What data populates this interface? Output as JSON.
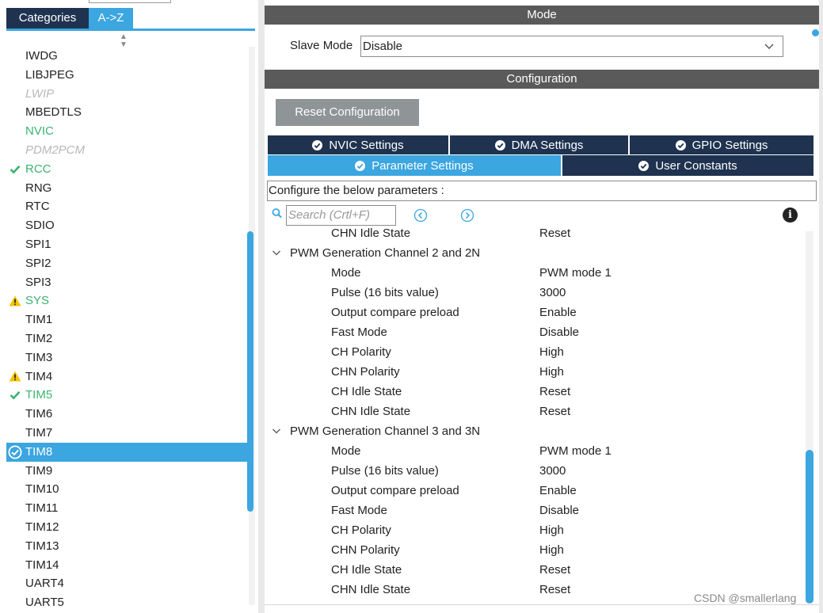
{
  "left_panel": {
    "tabs": [
      {
        "label": "Categories",
        "active": false
      },
      {
        "label": "A->Z",
        "active": true
      }
    ],
    "items": [
      {
        "label": "IWDG",
        "status": "normal",
        "icon": ""
      },
      {
        "label": "LIBJPEG",
        "status": "normal",
        "icon": ""
      },
      {
        "label": "LWIP",
        "status": "disabled",
        "icon": ""
      },
      {
        "label": "MBEDTLS",
        "status": "normal",
        "icon": ""
      },
      {
        "label": "NVIC",
        "status": "green",
        "icon": ""
      },
      {
        "label": "PDM2PCM",
        "status": "disabled",
        "icon": ""
      },
      {
        "label": "RCC",
        "status": "green",
        "icon": "check-icon"
      },
      {
        "label": "RNG",
        "status": "normal",
        "icon": ""
      },
      {
        "label": "RTC",
        "status": "normal",
        "icon": ""
      },
      {
        "label": "SDIO",
        "status": "normal",
        "icon": ""
      },
      {
        "label": "SPI1",
        "status": "normal",
        "icon": ""
      },
      {
        "label": "SPI2",
        "status": "normal",
        "icon": ""
      },
      {
        "label": "SPI3",
        "status": "normal",
        "icon": ""
      },
      {
        "label": "SYS",
        "status": "green",
        "icon": "warning-icon"
      },
      {
        "label": "TIM1",
        "status": "normal",
        "icon": ""
      },
      {
        "label": "TIM2",
        "status": "normal",
        "icon": ""
      },
      {
        "label": "TIM3",
        "status": "normal",
        "icon": ""
      },
      {
        "label": "TIM4",
        "status": "normal",
        "icon": "warning-icon"
      },
      {
        "label": "TIM5",
        "status": "green",
        "icon": "check-icon"
      },
      {
        "label": "TIM6",
        "status": "normal",
        "icon": ""
      },
      {
        "label": "TIM7",
        "status": "normal",
        "icon": ""
      },
      {
        "label": "TIM8",
        "status": "selected",
        "icon": "check-circle-icon"
      },
      {
        "label": "TIM9",
        "status": "normal",
        "icon": ""
      },
      {
        "label": "TIM10",
        "status": "normal",
        "icon": ""
      },
      {
        "label": "TIM11",
        "status": "normal",
        "icon": ""
      },
      {
        "label": "TIM12",
        "status": "normal",
        "icon": ""
      },
      {
        "label": "TIM13",
        "status": "normal",
        "icon": ""
      },
      {
        "label": "TIM14",
        "status": "normal",
        "icon": ""
      },
      {
        "label": "UART4",
        "status": "normal",
        "icon": ""
      },
      {
        "label": "UART5",
        "status": "normal",
        "icon": ""
      }
    ]
  },
  "mode": {
    "title": "Mode",
    "slave_mode_label": "Slave Mode",
    "slave_mode_value": "Disable"
  },
  "configuration": {
    "title": "Configuration",
    "reset_button": "Reset Configuration",
    "tabs_row1": [
      {
        "label": "NVIC Settings",
        "active": false
      },
      {
        "label": "DMA Settings",
        "active": false
      },
      {
        "label": "GPIO Settings",
        "active": false
      }
    ],
    "tabs_row2": [
      {
        "label": "Parameter Settings",
        "active": true
      },
      {
        "label": "User Constants",
        "active": false
      }
    ],
    "description": "Configure the below parameters :",
    "search_placeholder": "Search (Crtl+F)"
  },
  "parameters": [
    {
      "type": "param",
      "name": "CHN Idle State",
      "value": "Reset",
      "partial": true
    },
    {
      "type": "group",
      "name": "PWM Generation Channel 2 and 2N"
    },
    {
      "type": "param",
      "name": "Mode",
      "value": "PWM mode 1"
    },
    {
      "type": "param",
      "name": "Pulse (16 bits value)",
      "value": "3000"
    },
    {
      "type": "param",
      "name": "Output compare preload",
      "value": "Enable"
    },
    {
      "type": "param",
      "name": "Fast Mode",
      "value": "Disable"
    },
    {
      "type": "param",
      "name": "CH Polarity",
      "value": "High"
    },
    {
      "type": "param",
      "name": "CHN Polarity",
      "value": "High"
    },
    {
      "type": "param",
      "name": "CH Idle State",
      "value": "Reset"
    },
    {
      "type": "param",
      "name": "CHN Idle State",
      "value": "Reset"
    },
    {
      "type": "group",
      "name": "PWM Generation Channel 3 and 3N"
    },
    {
      "type": "param",
      "name": "Mode",
      "value": "PWM mode 1"
    },
    {
      "type": "param",
      "name": "Pulse (16 bits value)",
      "value": "3000"
    },
    {
      "type": "param",
      "name": "Output compare preload",
      "value": "Enable"
    },
    {
      "type": "param",
      "name": "Fast Mode",
      "value": "Disable"
    },
    {
      "type": "param",
      "name": "CH Polarity",
      "value": "High"
    },
    {
      "type": "param",
      "name": "CHN Polarity",
      "value": "High"
    },
    {
      "type": "param",
      "name": "CH Idle State",
      "value": "Reset"
    },
    {
      "type": "param",
      "name": "CHN Idle State",
      "value": "Reset"
    }
  ],
  "watermark": "CSDN @smallerlang",
  "colors": {
    "accent": "#3ba6e0",
    "dark_tab": "#1f3350",
    "header_bar": "#5a5a5a",
    "ok_green": "#3cb371",
    "warning": "#f5c400"
  }
}
